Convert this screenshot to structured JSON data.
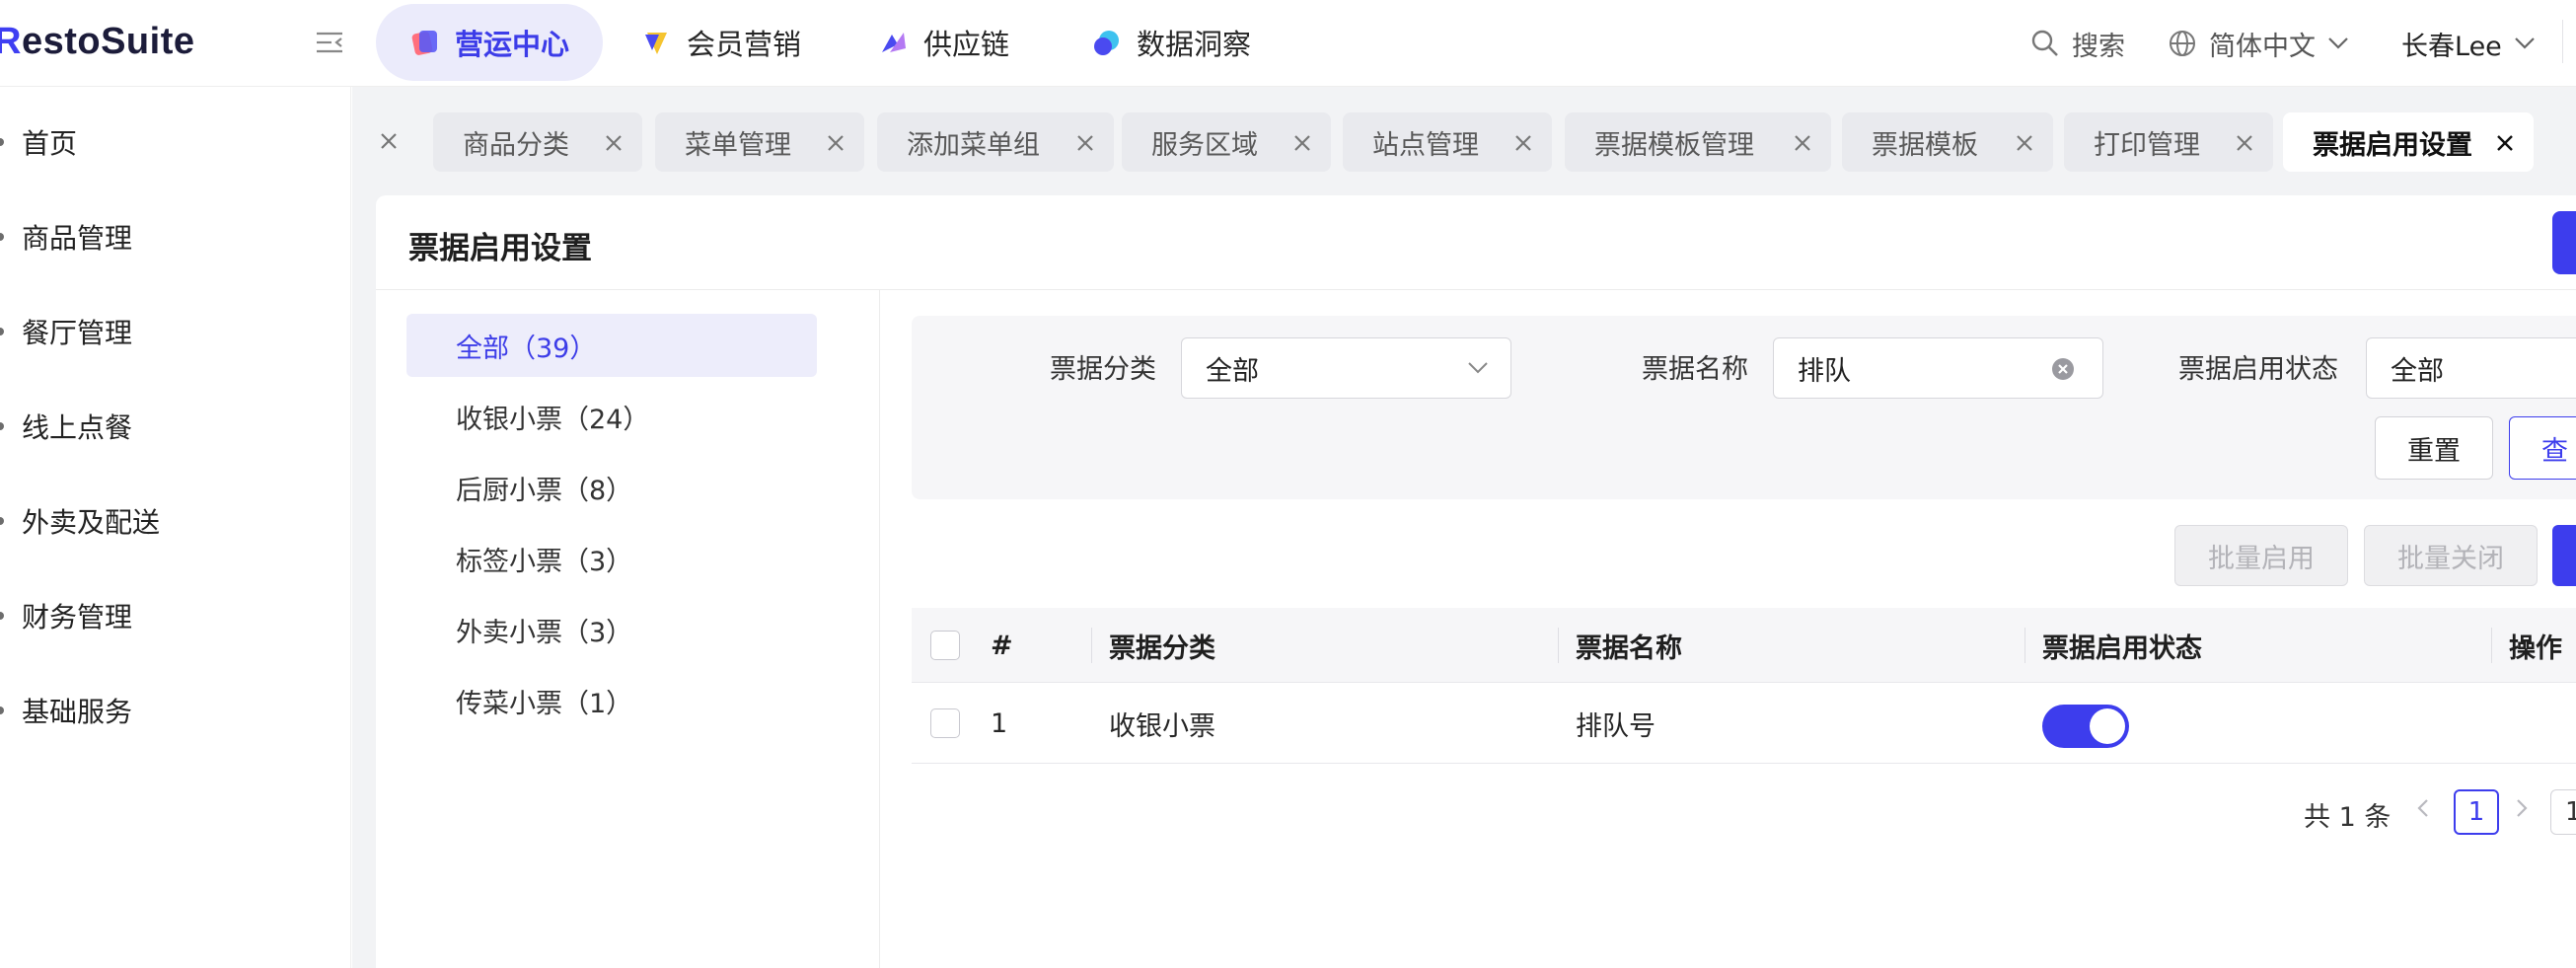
{
  "app": {
    "logo_text": "RestoSuite",
    "logo_initial": "R",
    "logo_rest": "estoSuite"
  },
  "header": {
    "modules": [
      {
        "label": "营运中心",
        "active": true
      },
      {
        "label": "会员营销",
        "active": false
      },
      {
        "label": "供应链",
        "active": false
      },
      {
        "label": "数据洞察",
        "active": false
      }
    ],
    "search_label": "搜索",
    "language": "简体中文",
    "user": "长春Lee"
  },
  "sidebar": {
    "items": [
      {
        "label": "首页"
      },
      {
        "label": "商品管理"
      },
      {
        "label": "餐厅管理"
      },
      {
        "label": "线上点餐"
      },
      {
        "label": "外卖及配送"
      },
      {
        "label": "财务管理"
      },
      {
        "label": "基础服务"
      }
    ]
  },
  "tabs": [
    {
      "label": "商品分类"
    },
    {
      "label": "菜单管理"
    },
    {
      "label": "添加菜单组"
    },
    {
      "label": "服务区域"
    },
    {
      "label": "站点管理"
    },
    {
      "label": "票据模板管理"
    },
    {
      "label": "票据模板"
    },
    {
      "label": "打印管理"
    },
    {
      "label": "票据启用设置",
      "active": true
    }
  ],
  "page": {
    "title": "票据启用设置",
    "categories": [
      {
        "label": "全部（39）",
        "active": true
      },
      {
        "label": "收银小票（24）"
      },
      {
        "label": "后厨小票（8）"
      },
      {
        "label": "标签小票（3）"
      },
      {
        "label": "外卖小票（3）"
      },
      {
        "label": "传菜小票（1）"
      }
    ],
    "filters": {
      "category_label": "票据分类",
      "category_value": "全部",
      "name_label": "票据名称",
      "name_value": "排队",
      "status_label": "票据启用状态",
      "status_value": "全部",
      "reset_label": "重置",
      "query_label": "查"
    },
    "actions": {
      "batch_enable": "批量启用",
      "batch_disable": "批量关闭"
    },
    "table": {
      "headers": {
        "index": "#",
        "category": "票据分类",
        "name": "票据名称",
        "status": "票据启用状态",
        "operation": "操作"
      },
      "rows": [
        {
          "index": "1",
          "category": "收银小票",
          "name": "排队号",
          "enabled": true
        }
      ]
    },
    "pagination": {
      "total": "共 1 条",
      "current_page": "1",
      "goto_value": "1"
    }
  },
  "colors": {
    "accent": "#3d3ded",
    "active_bg": "#ebebfb",
    "main_bg": "#f2f3f5"
  }
}
